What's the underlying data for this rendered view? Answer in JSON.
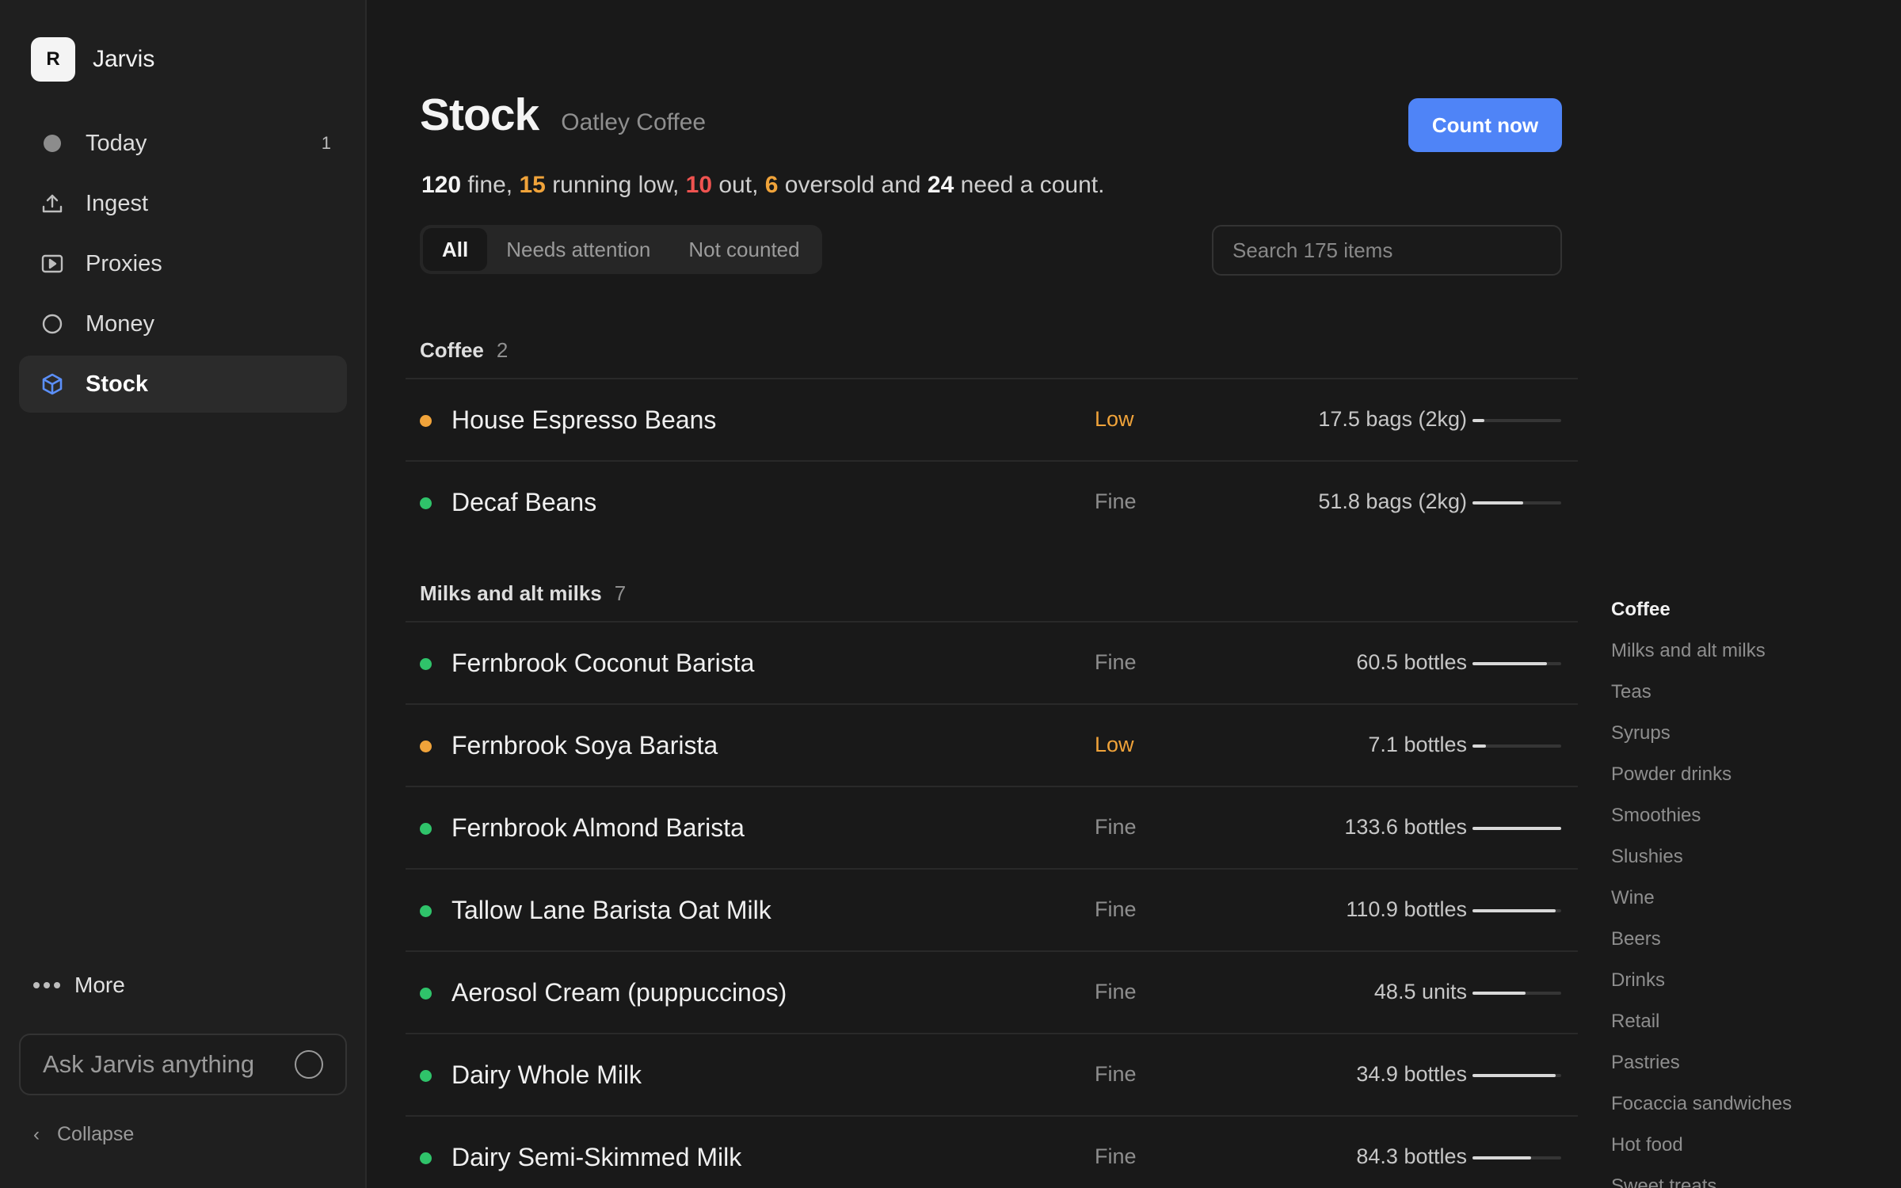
{
  "app": {
    "logo_letter": "R",
    "name": "Jarvis"
  },
  "nav": [
    {
      "label": "Today",
      "icon": "dot-icon",
      "badge": "1",
      "active": false
    },
    {
      "label": "Ingest",
      "icon": "upload-icon",
      "badge": "",
      "active": false
    },
    {
      "label": "Proxies",
      "icon": "play-square-icon",
      "badge": "",
      "active": false
    },
    {
      "label": "Money",
      "icon": "circle-icon",
      "badge": "",
      "active": false
    },
    {
      "label": "Stock",
      "icon": "cube-icon",
      "badge": "",
      "active": true
    }
  ],
  "sidebar_footer": {
    "more_label": "More",
    "ask_placeholder": "Ask Jarvis anything",
    "collapse_label": "Collapse"
  },
  "header": {
    "title": "Stock",
    "subtitle": "Oatley Coffee",
    "count_button": "Count now"
  },
  "summary": {
    "fine": "120",
    "fine_label": "fine,",
    "low": "15",
    "low_label": "running low,",
    "out": "10",
    "out_label": "out,",
    "oversold": "6",
    "oversold_label": "oversold and",
    "count": "24",
    "count_label": "need a count."
  },
  "tabs": [
    "All",
    "Needs attention",
    "Not counted"
  ],
  "search": {
    "placeholder": "Search 175 items"
  },
  "colors": {
    "accent": "#4f84f7",
    "fine": "#2fc36a",
    "low": "#f0a33a",
    "out": "#ef5350"
  },
  "groups": [
    {
      "name": "Coffee",
      "count": "2",
      "items": [
        {
          "name": "House Espresso Beans",
          "status": "Low",
          "qty": "17.5 bags (2kg)",
          "level": 0.13
        },
        {
          "name": "Decaf Beans",
          "status": "Fine",
          "qty": "51.8 bags (2kg)",
          "level": 0.57
        }
      ]
    },
    {
      "name": "Milks and alt milks",
      "count": "7",
      "items": [
        {
          "name": "Fernbrook Coconut Barista",
          "status": "Fine",
          "qty": "60.5 bottles",
          "level": 0.84
        },
        {
          "name": "Fernbrook Soya Barista",
          "status": "Low",
          "qty": "7.1 bottles",
          "level": 0.15
        },
        {
          "name": "Fernbrook Almond Barista",
          "status": "Fine",
          "qty": "133.6 bottles",
          "level": 1.0
        },
        {
          "name": "Tallow Lane Barista Oat Milk",
          "status": "Fine",
          "qty": "110.9 bottles",
          "level": 0.94
        },
        {
          "name": "Aerosol Cream (puppuccinos)",
          "status": "Fine",
          "qty": "48.5 units",
          "level": 0.6
        },
        {
          "name": "Dairy Whole Milk",
          "status": "Fine",
          "qty": "34.9 bottles",
          "level": 0.94
        },
        {
          "name": "Dairy Semi-Skimmed Milk",
          "status": "Fine",
          "qty": "84.3 bottles",
          "level": 0.66
        }
      ]
    }
  ],
  "category_index": [
    "Coffee",
    "Milks and alt milks",
    "Teas",
    "Syrups",
    "Powder drinks",
    "Smoothies",
    "Slushies",
    "Wine",
    "Beers",
    "Drinks",
    "Retail",
    "Pastries",
    "Focaccia sandwiches",
    "Hot food",
    "Sweet treats"
  ]
}
